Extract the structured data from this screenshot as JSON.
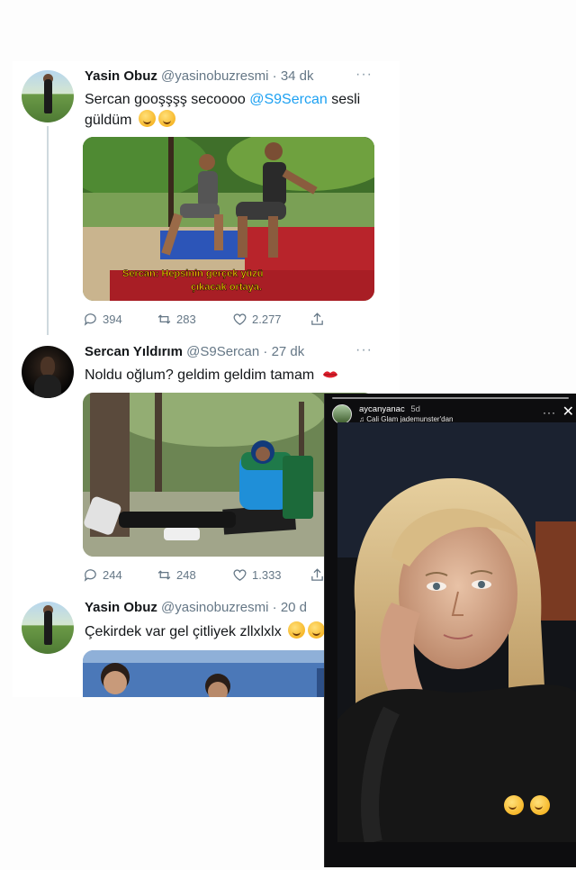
{
  "tweets": [
    {
      "name": "Yasin Obuz",
      "handle": "@yasinobuzresmi",
      "time": "34 dk",
      "text_before": "Sercan gooşşşş secoooo",
      "mention": "@S9Sercan",
      "text_after": "sesli güldüm",
      "media_caption_line1": "Sercan: Hepsinin gerçek yüzü",
      "media_caption_line2": "çıkacak ortaya.",
      "replies": "394",
      "retweets": "283",
      "likes": "2.277"
    },
    {
      "name": "Sercan Yıldırım",
      "handle": "@S9Sercan",
      "time": "27 dk",
      "text": "Noldu oğlum? geldim geldim tamam",
      "replies": "244",
      "retweets": "248",
      "likes": "1.333"
    },
    {
      "name": "Yasin Obuz",
      "handle": "@yasinobuzresmi",
      "time": "20 d",
      "text": "Çekirdek var gel çitliyek zllxlxlx"
    }
  ],
  "story": {
    "username": "aycanyanac",
    "time": "5d",
    "music": "♫ Cali Glam jademunster'dan"
  },
  "icons": [
    "reply-icon",
    "retweet-icon",
    "like-icon",
    "share-icon",
    "more-icon",
    "close-icon",
    "kiss-emoji",
    "grin-emoji",
    "worried-emoji"
  ]
}
